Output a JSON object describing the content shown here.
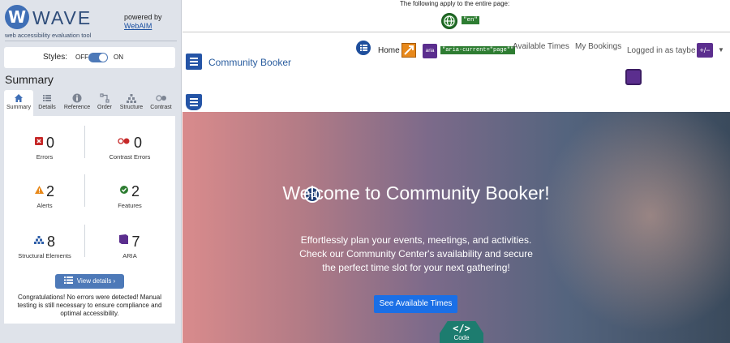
{
  "wave": {
    "logo_letter": "W",
    "title": "WAVE",
    "subtitle": "web accessibility evaluation tool",
    "powered_by": "powered by",
    "powered_link": "WebAIM",
    "styles_label": "Styles:",
    "styles_off": "OFF",
    "styles_on": "ON",
    "styles_enabled": true,
    "summary_heading": "Summary",
    "tabs": [
      {
        "label": "Summary",
        "icon": "home-icon"
      },
      {
        "label": "Details",
        "icon": "list-icon"
      },
      {
        "label": "Reference",
        "icon": "info-icon"
      },
      {
        "label": "Order",
        "icon": "order-icon"
      },
      {
        "label": "Structure",
        "icon": "structure-icon"
      },
      {
        "label": "Contrast",
        "icon": "contrast-icon"
      }
    ],
    "stats": {
      "errors": {
        "count": "0",
        "label": "Errors"
      },
      "contrast_errors": {
        "count": "0",
        "label": "Contrast Errors"
      },
      "alerts": {
        "count": "2",
        "label": "Alerts"
      },
      "features": {
        "count": "2",
        "label": "Features"
      },
      "structural": {
        "count": "8",
        "label": "Structural Elements"
      },
      "aria": {
        "count": "7",
        "label": "ARIA"
      }
    },
    "view_details": "View details ›",
    "congrats": "Congratulations! No errors were detected! Manual testing is still necessary to ensure compliance and optimal accessibility."
  },
  "page": {
    "entire_page_text": "The following apply to the entire page:",
    "lang_tag": "\"en\"",
    "brand": "Community Booker",
    "nav": {
      "home": "Home",
      "aria_icon_text": "aria",
      "aria_current": "\"aria-current=\"page\"\"",
      "available_times": "Available Times",
      "my_bookings": "My Bookings",
      "logged_in": "Logged in as taybe",
      "plusminus": "+/−"
    },
    "hero": {
      "h1_badge": "h1",
      "title": "Welcome to Community Booker!",
      "text": "Effortlessly plan your events, meetings, and activities. Check our Community Center's availability and secure the perfect time slot for your next gathering!",
      "cta": "See Available Times"
    },
    "code_button": {
      "brackets": "</>",
      "label": "Code"
    }
  },
  "colors": {
    "wave_blue": "#3f6fb6",
    "error_red": "#c62828",
    "alert_orange": "#e8891b",
    "feature_green": "#2e7d32",
    "aria_purple": "#5b2e8e",
    "cta_blue": "#1a6fe6",
    "code_teal": "#1d7c6f"
  }
}
